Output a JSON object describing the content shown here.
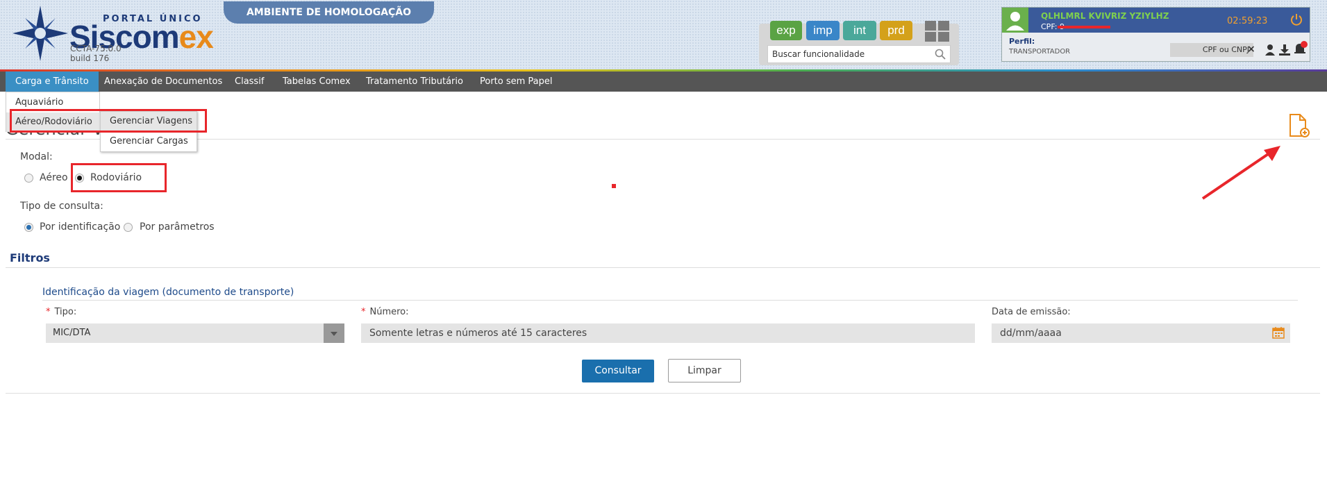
{
  "header": {
    "portal_label": "PORTAL ÚNICO",
    "brand_main": "Siscom",
    "brand_ex": "ex",
    "version": "CCTA-75.0.0",
    "build": "build 176",
    "environment": "AMBIENTE DE HOMOLOGAÇÃO",
    "shortcuts": [
      {
        "label": "exp",
        "color": "#5aa344"
      },
      {
        "label": "imp",
        "color": "#3a86c8"
      },
      {
        "label": "int",
        "color": "#4aa89a"
      },
      {
        "label": "prd",
        "color": "#d4a11a"
      }
    ],
    "search_placeholder": "Buscar funcionalidade",
    "user": {
      "name": "QLHLMRL KVIVRIZ YZIYLHZ",
      "cpf_label": "CPF: 9",
      "timer": "02:59:23",
      "perfil_label": "Perfil:",
      "perfil_value": "TRANSPORTADOR",
      "cpf_cnpj_placeholder": "CPF ou CNPJ",
      "clear": "×"
    }
  },
  "nav": {
    "items": [
      "Carga e Trânsito",
      "Anexação de Documentos",
      "Classif",
      "Tabelas Comex",
      "Tratamento Tributário",
      "Porto sem Papel"
    ],
    "dropdown": [
      "Aquaviário",
      "Aéreo/Rodoviário"
    ],
    "submenu": [
      "Gerenciar Viagens",
      "Gerenciar Cargas"
    ]
  },
  "page": {
    "title": "Gerenciar Via",
    "modal_label": "Modal:",
    "modal_options": [
      "Aéreo",
      "Rodoviário"
    ],
    "tipo_consulta_label": "Tipo de consulta:",
    "tipo_consulta_options": [
      "Por identificação",
      "Por parâmetros"
    ],
    "filters_title": "Filtros",
    "group_title": "Identificação da viagem (documento de transporte)",
    "required_mark": "*",
    "fields": {
      "tipo_label": "Tipo:",
      "tipo_value": "MIC/DTA",
      "numero_label": "Número:",
      "numero_placeholder": "Somente letras e números até 15 caracteres",
      "data_label": "Data de emissão:",
      "data_placeholder": "dd/mm/aaaa"
    },
    "buttons": {
      "consultar": "Consultar",
      "limpar": "Limpar"
    }
  },
  "colors": {
    "accent": "#1a6fad",
    "nav_active": "#3a8fc4",
    "highlight": "#e8262b"
  }
}
